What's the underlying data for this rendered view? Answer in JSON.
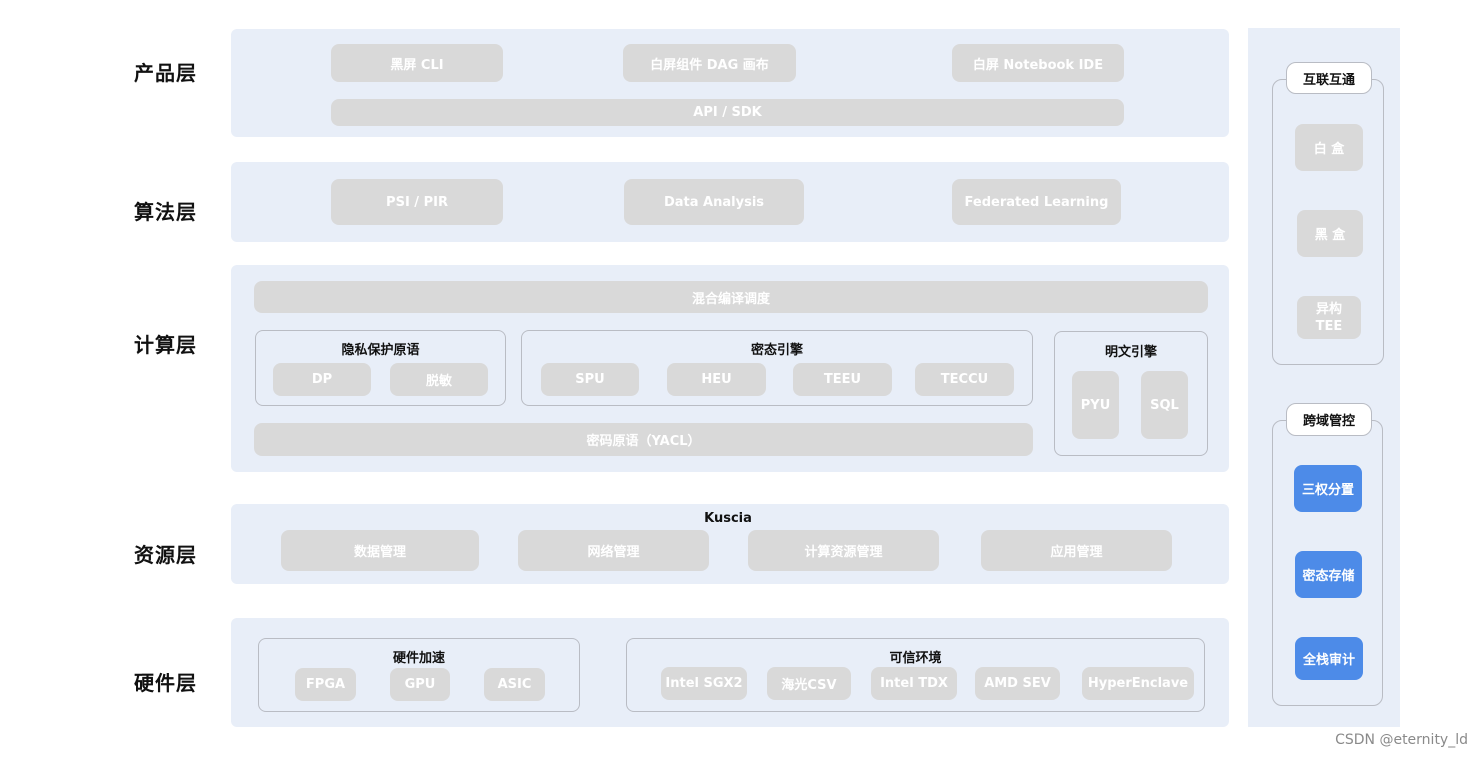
{
  "layers": {
    "product": "产品层",
    "algorithm": "算法层",
    "compute": "计算层",
    "resource": "资源层",
    "hardware": "硬件层"
  },
  "product": {
    "items": [
      "黑屏 CLI",
      "白屏组件 DAG 画布",
      "白屏 Notebook IDE"
    ],
    "api": "API / SDK"
  },
  "algorithm": {
    "items": [
      "PSI / PIR",
      "Data Analysis",
      "Federated Learning"
    ]
  },
  "compute": {
    "scheduler": "混合编译调度",
    "privacy": {
      "title": "隐私保护原语",
      "items": [
        "DP",
        "脱敏"
      ]
    },
    "cipher_engine": {
      "title": "密态引擎",
      "items": [
        "SPU",
        "HEU",
        "TEEU",
        "TECCU"
      ]
    },
    "plain_engine": {
      "title": "明文引擎",
      "items": [
        "PYU",
        "SQL"
      ]
    },
    "yacl": "密码原语（YACL）"
  },
  "resource": {
    "title": "Kuscia",
    "items": [
      "数据管理",
      "网络管理",
      "计算资源管理",
      "应用管理"
    ]
  },
  "hardware": {
    "accel": {
      "title": "硬件加速",
      "items": [
        "FPGA",
        "GPU",
        "ASIC"
      ]
    },
    "trusted": {
      "title": "可信环境",
      "items": [
        "Intel SGX2",
        "海光CSV",
        "Intel TDX",
        "AMD SEV",
        "HyperEnclave"
      ]
    }
  },
  "side": {
    "interop": {
      "title": "互联互通",
      "items": [
        "白 盒",
        "黑 盒",
        "异构\nTEE"
      ]
    },
    "governance": {
      "title": "跨域管控",
      "items": [
        "三权分置",
        "密态存储",
        "全栈审计"
      ]
    }
  },
  "watermark": "CSDN @eternity_ld",
  "colors": {
    "band": "#e8eef8",
    "chip": "#d9d9d9",
    "accent": "#4d8be8"
  }
}
